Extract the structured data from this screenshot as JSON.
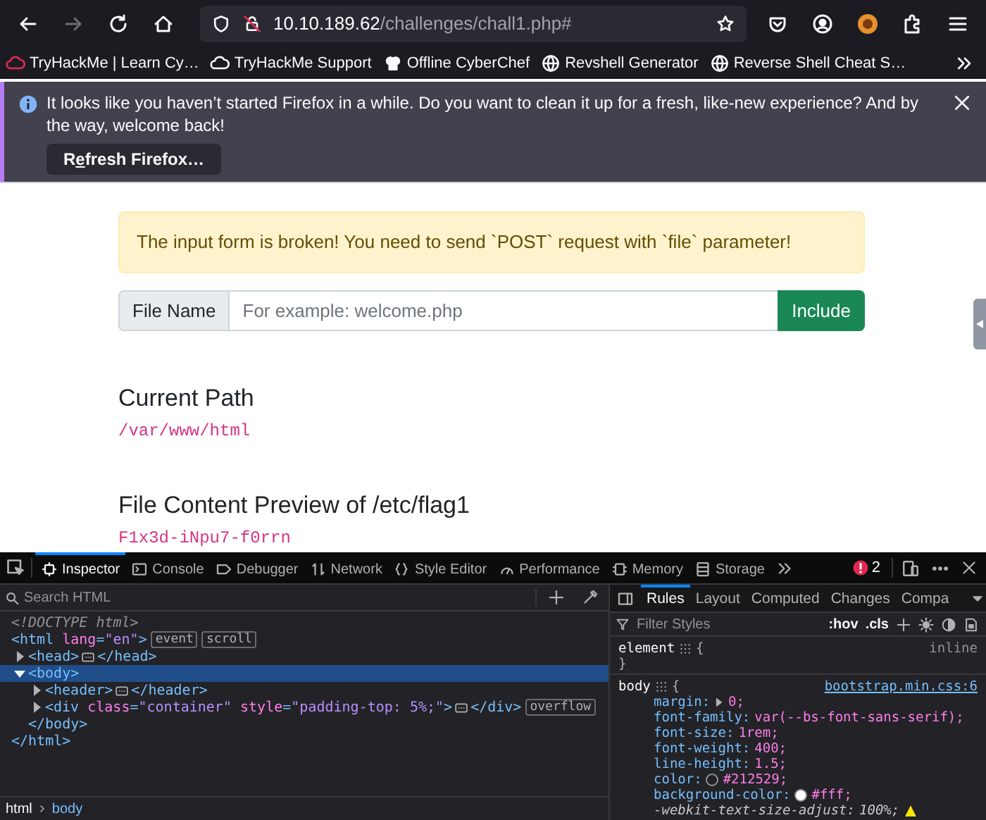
{
  "browser": {
    "nav": [
      {
        "kind": "back",
        "disabled": false
      },
      {
        "kind": "forward",
        "disabled": true
      },
      {
        "kind": "reload",
        "disabled": false
      },
      {
        "kind": "home",
        "disabled": false
      }
    ],
    "url": {
      "host": "10.10.189.62",
      "path": "/challenges/chall1.php#"
    },
    "bookmarks": [
      {
        "label": "TryHackMe | Learn Cy…"
      },
      {
        "label": "TryHackMe Support"
      },
      {
        "label": "Offline CyberChef"
      },
      {
        "label": "Revshell Generator"
      },
      {
        "label": "Reverse Shell Cheat S…"
      }
    ],
    "notification": {
      "message": "It looks like you haven’t started Firefox in a while. Do you want to clean it up for a fresh, like-new experience? And by the way, welcome back!",
      "button": {
        "before": "R",
        "key": "e",
        "after": "fresh Firefox…"
      }
    }
  },
  "page": {
    "alert": "The input form is broken! You need to send `POST` request with `file` parameter!",
    "input_group": {
      "label": "File Name",
      "placeholder": "For example: welcome.php",
      "button": "Include"
    },
    "sections": [
      {
        "heading": "Current Path",
        "value": "/var/www/html"
      },
      {
        "heading": "File Content Preview of /etc/flag1",
        "value": "F1x3d-iNpu7-f0rrn"
      }
    ]
  },
  "devtools": {
    "tabs": [
      {
        "label": "Inspector",
        "selected": true
      },
      {
        "label": "Console",
        "selected": false
      },
      {
        "label": "Debugger",
        "selected": false
      },
      {
        "label": "Network",
        "selected": false
      },
      {
        "label": "Style Editor",
        "selected": false
      },
      {
        "label": "Performance",
        "selected": false
      },
      {
        "label": "Memory",
        "selected": false
      },
      {
        "label": "Storage",
        "selected": false
      }
    ],
    "error_count": "2",
    "search": {
      "placeholder": "Search HTML"
    },
    "markup": [
      {
        "kind": "doctype",
        "text": "<!DOCTYPE html>"
      },
      {
        "kind": "element",
        "open": "<html lang=\"en\">",
        "close": "</html>",
        "selected": false,
        "badges": [
          "event",
          "scroll"
        ],
        "children": [
          {
            "kind": "element",
            "open": "<head>",
            "close": "</head>",
            "expanded": false,
            "selected": false
          },
          {
            "kind": "element",
            "open": "<body>",
            "close": "</body>",
            "expanded": true,
            "selected": true,
            "children": [
              {
                "kind": "element",
                "open": "<header>",
                "close": "</header>",
                "expanded": false,
                "selected": false
              },
              {
                "kind": "element",
                "open": "<div class=\"container\" style=\"padding-top: 5%;\">",
                "close": "</div>",
                "expanded": false,
                "selected": false,
                "badges": [
                  "overflow"
                ]
              }
            ]
          }
        ]
      }
    ],
    "breadcrumbs": [
      {
        "label": "html",
        "selected": false
      },
      {
        "label": "body",
        "selected": true
      }
    ],
    "side_tabs": [
      {
        "label": "Rules",
        "selected": true
      },
      {
        "label": "Layout",
        "selected": false
      },
      {
        "label": "Computed",
        "selected": false
      },
      {
        "label": "Changes",
        "selected": false
      },
      {
        "label": "Compa",
        "selected": false
      }
    ],
    "filter": {
      "placeholder": "Filter Styles",
      "toggles": [
        ":hov",
        ".cls"
      ]
    },
    "rules": [
      {
        "selector": "element",
        "open": "{",
        "source": "inline",
        "close": "}"
      },
      {
        "selector": "body",
        "open": "{",
        "source": "bootstrap.min.css:6",
        "declarations": [
          {
            "name": "margin:",
            "value": "0;",
            "expander": true,
            "swatch": false,
            "overridden": false
          },
          {
            "name": "font-family:",
            "value": "var(--bs-font-sans-serif);",
            "expander": false,
            "swatch": false,
            "overridden": false
          },
          {
            "name": "font-size:",
            "value": "1rem;",
            "expander": false,
            "swatch": false,
            "overridden": false
          },
          {
            "name": "font-weight:",
            "value": "400;",
            "expander": false,
            "swatch": false,
            "overridden": false
          },
          {
            "name": "line-height:",
            "value": "1.5;",
            "expander": false,
            "swatch": false,
            "overridden": false
          },
          {
            "name": "color:",
            "value": "#212529;",
            "expander": false,
            "swatch": true,
            "overridden": false
          },
          {
            "name": "background-color:",
            "value": "#fff;",
            "expander": false,
            "swatch": true,
            "overridden": false
          },
          {
            "name": "-webkit-text-size-adjust:",
            "value": "100%;",
            "expander": false,
            "swatch": false,
            "overridden": true
          }
        ]
      }
    ]
  }
}
